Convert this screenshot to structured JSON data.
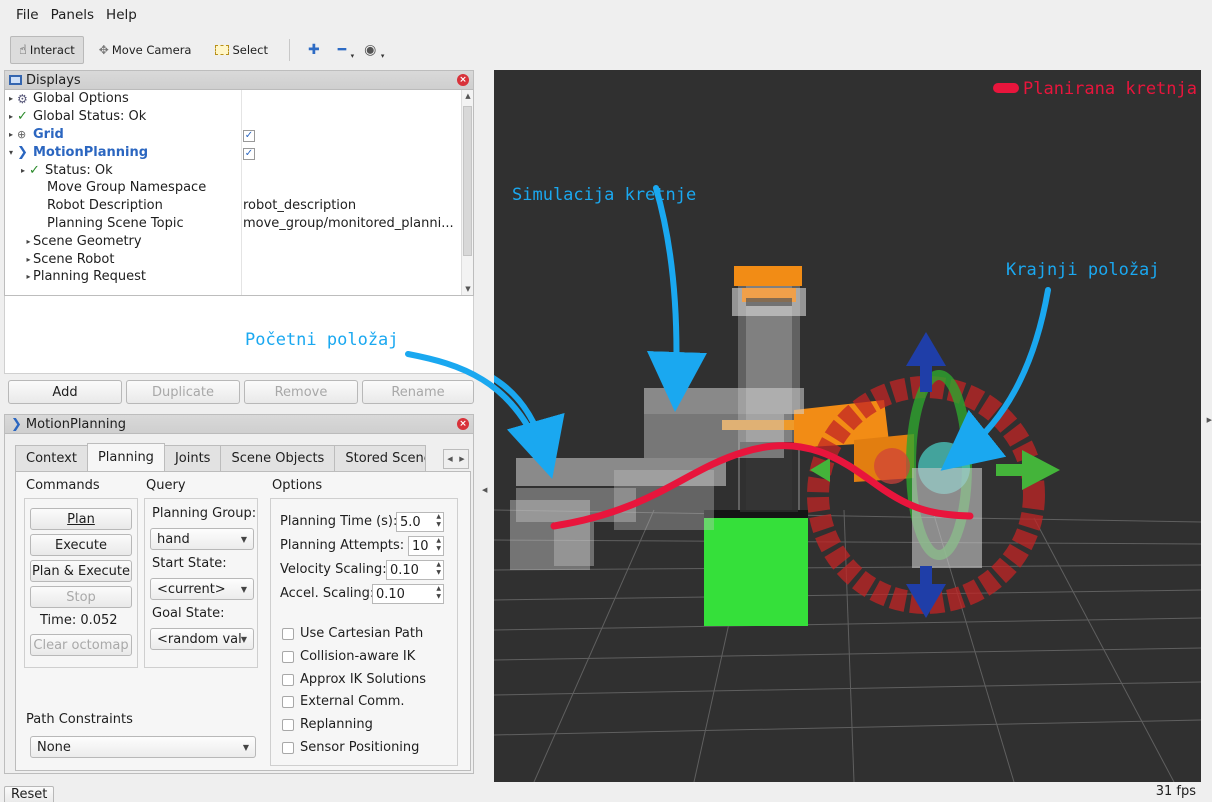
{
  "menu": [
    "File",
    "Panels",
    "Help"
  ],
  "toolbar": {
    "interact": "Interact",
    "move_camera": "Move Camera",
    "select": "Select"
  },
  "displays": {
    "title": "Displays",
    "rows": [
      {
        "label": "Global Options",
        "value": ""
      },
      {
        "label": "Global Status: Ok",
        "value": ""
      },
      {
        "label": "Grid",
        "value": ""
      },
      {
        "label": "MotionPlanning",
        "value": ""
      },
      {
        "label": "Status: Ok",
        "value": ""
      },
      {
        "label": "Move Group Namespace",
        "value": ""
      },
      {
        "label": "Robot Description",
        "value": "robot_description"
      },
      {
        "label": "Planning Scene Topic",
        "value": "move_group/monitored_planni..."
      },
      {
        "label": "Scene Geometry",
        "value": ""
      },
      {
        "label": "Scene Robot",
        "value": ""
      },
      {
        "label": "Planning Request",
        "value": ""
      }
    ],
    "buttons": [
      "Add",
      "Duplicate",
      "Remove",
      "Rename"
    ]
  },
  "motion_planning": {
    "title": "MotionPlanning",
    "tabs": [
      "Context",
      "Planning",
      "Joints",
      "Scene Objects",
      "Stored Scene"
    ],
    "active_tab": "Planning",
    "commands": {
      "label": "Commands",
      "plan": "Plan",
      "execute": "Execute",
      "plan_execute": "Plan & Execute",
      "stop": "Stop",
      "time": "Time: 0.052",
      "clear_octomap": "Clear octomap"
    },
    "query": {
      "label": "Query",
      "planning_group_label": "Planning Group:",
      "planning_group": "hand",
      "start_state_label": "Start State:",
      "start_state": "<current>",
      "goal_state_label": "Goal State:",
      "goal_state": "<random val"
    },
    "options": {
      "label": "Options",
      "planning_time_label": "Planning Time (s):",
      "planning_time": "5.0",
      "planning_attempts_label": "Planning Attempts:",
      "planning_attempts": "10",
      "velocity_scaling_label": "Velocity Scaling:",
      "velocity_scaling": "0.10",
      "accel_scaling_label": "Accel. Scaling:",
      "accel_scaling": "0.10",
      "checkboxes": [
        "Use Cartesian Path",
        "Collision-aware IK",
        "Approx IK Solutions",
        "External Comm.",
        "Replanning",
        "Sensor Positioning"
      ]
    },
    "path_constraints": {
      "label": "Path Constraints",
      "value": "None"
    }
  },
  "viewport": {
    "legend": "Planirana kretnja",
    "annotation_sim": "Simulacija kretnje",
    "annotation_end": "Krajnji položaj",
    "annotation_start": "Početni položaj",
    "colors": {
      "path": "#e8153c",
      "annotation": "#1aa8f0",
      "box": "#35e03a",
      "robot": "#f28c15"
    }
  },
  "status": {
    "reset": "Reset",
    "fps": "31 fps"
  }
}
